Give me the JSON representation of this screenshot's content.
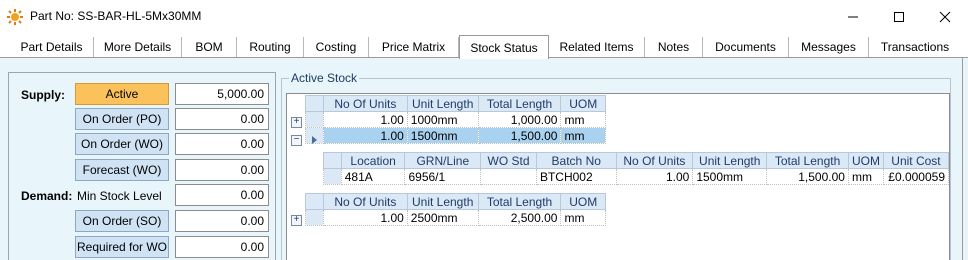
{
  "window": {
    "title": "Part No: SS-BAR-HL-5Mx30MM",
    "icons": {
      "app": "gear-sun-icon",
      "minimize": "minimize-icon",
      "maximize": "maximize-icon",
      "close": "close-icon"
    }
  },
  "tabs": [
    {
      "label": "Part Details"
    },
    {
      "label": "More Details"
    },
    {
      "label": "BOM"
    },
    {
      "label": "Routing"
    },
    {
      "label": "Costing"
    },
    {
      "label": "Price Matrix"
    },
    {
      "label": "Stock Status",
      "active": true
    },
    {
      "label": "Related Items"
    },
    {
      "label": "Notes"
    },
    {
      "label": "Documents"
    },
    {
      "label": "Messages"
    },
    {
      "label": "Transactions"
    }
  ],
  "left": {
    "supply_label": "Supply:",
    "demand_label": "Demand:",
    "min_stock_label": "Min Stock Level",
    "buttons": {
      "active": "Active",
      "on_order_po": "On Order (PO)",
      "on_order_wo": "On Order (WO)",
      "forecast_wo": "Forecast (WO)",
      "on_order_so": "On Order (SO)",
      "required_for_wo": "Required for WO"
    },
    "values": {
      "active": "5,000.00",
      "on_order_po": "0.00",
      "on_order_wo": "0.00",
      "forecast_wo": "0.00",
      "min_stock": "0.00",
      "on_order_so": "0.00",
      "required_for_wo": "0.00"
    }
  },
  "active_stock": {
    "title": "Active Stock",
    "headers": [
      "No Of Units",
      "Unit Length",
      "Total Length",
      "UOM"
    ],
    "rows": [
      {
        "units": "1.00",
        "length": "1000mm",
        "total": "1,000.00",
        "uom": "mm"
      },
      {
        "units": "1.00",
        "length": "1500mm",
        "total": "1,500.00",
        "uom": "mm"
      }
    ],
    "detail_headers": [
      "Location",
      "GRN/Line",
      "WO Std",
      "Batch No",
      "No Of Units",
      "Unit Length",
      "Total Length",
      "UOM",
      "Unit Cost"
    ],
    "detail_row": {
      "location": "481A",
      "grn": "6956/1",
      "wo_std": "",
      "batch": "BTCH002",
      "units": "1.00",
      "length": "1500mm",
      "total": "1,500.00",
      "uom": "mm",
      "cost": "£0.000059"
    },
    "headers2": [
      "No Of Units",
      "Unit Length",
      "Total Length",
      "UOM"
    ],
    "row3": {
      "units": "1.00",
      "length": "2500mm",
      "total": "2,500.00",
      "uom": "mm"
    }
  }
}
